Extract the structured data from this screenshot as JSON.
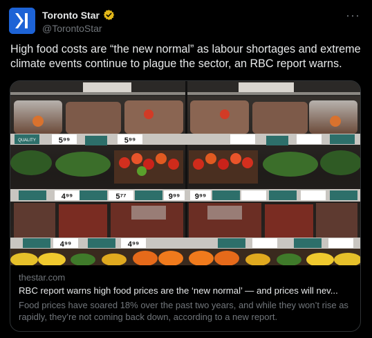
{
  "account": {
    "name": "Toronto Star",
    "handle": "@TorontoStar",
    "verified_color": "#e2b719",
    "avatar_color": "#1d63d6"
  },
  "more_label": "···",
  "tweet_text": "High food costs are “the new normal” as labour shortages and extreme climate events continue to plague the sector, an RBC report warns.",
  "card": {
    "domain": "thestar.com",
    "title": "RBC report warns high food prices are the ‘new normal’ — and prices will nev...",
    "description": "Food prices have soared 18% over the past two years, and while they won’t rise as rapidly, they’re not coming back down, according to a new report.",
    "image": {
      "tags_row1": [
        "5⁹⁹",
        "5⁹⁹"
      ],
      "tags_row2": [
        "4⁹⁹",
        "5⁷⁷",
        "9⁹⁹",
        "9⁹⁹"
      ],
      "tags_row3": [
        "4⁹⁹",
        "4⁹⁹"
      ],
      "shelf_labels": [
        "QUALITY YOU TRUST"
      ]
    }
  }
}
